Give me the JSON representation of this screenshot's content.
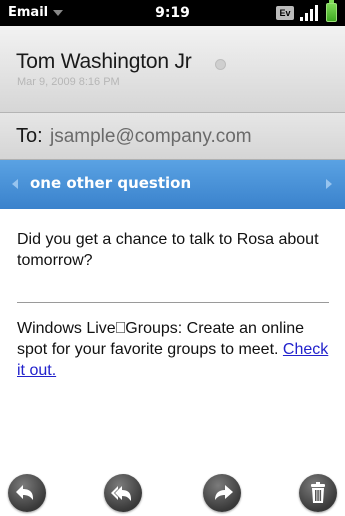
{
  "status_bar": {
    "app_menu_label": "Email",
    "time": "9:19",
    "network_label": "Ev",
    "icons": [
      "dropdown-caret",
      "ev-network",
      "signal-bars",
      "battery"
    ]
  },
  "message": {
    "sender_name": "Tom Washington Jr",
    "date": "Mar 9, 2009 8:16 PM",
    "to_label": "To:",
    "to_address": "jsample@company.com",
    "subject": "one other question",
    "body": "Did you get a chance to talk to Rosa about tomorrow?",
    "footer_text": "Windows Live⎕Groups: Create an online spot for your favorite groups to meet.",
    "footer_link": "Check it out."
  },
  "toolbar": {
    "buttons": [
      "reply-icon",
      "reply-all-icon",
      "forward-icon",
      "trash-icon"
    ]
  },
  "colors": {
    "subject_bar": "#4a92d8",
    "link": "#2222cc"
  }
}
